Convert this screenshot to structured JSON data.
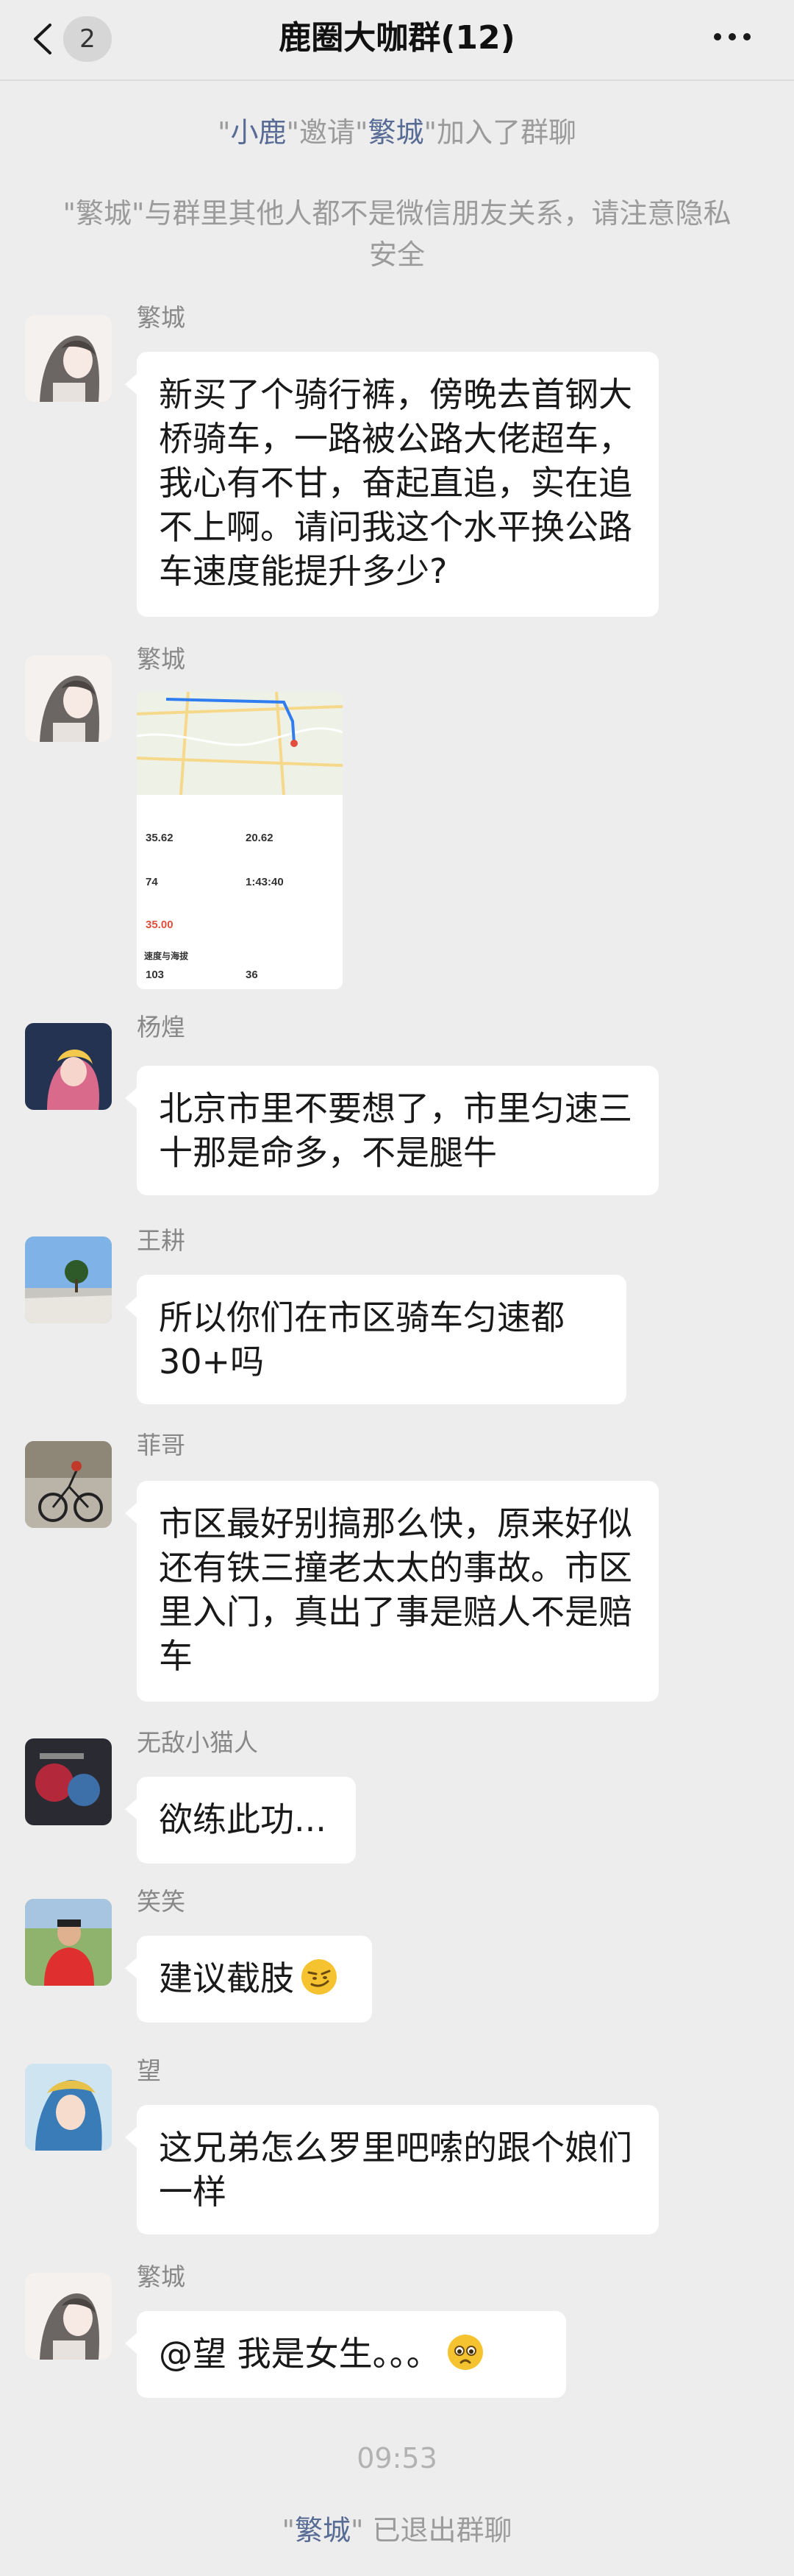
{
  "header": {
    "badge": "2",
    "title": "鹿圈大咖群(12)"
  },
  "notices": {
    "invite": {
      "q1": "\"",
      "inviter": "小鹿",
      "q2": "\"邀请\"",
      "invitee": "繁城",
      "q3": "\"加入了群聊"
    },
    "privacy": "\"繁城\"与群里其他人都不是微信朋友关系，请注意隐私安全",
    "left": {
      "q1": "\"",
      "name": "繁城",
      "q2": "\" 已退出群聊"
    }
  },
  "messages": [
    {
      "sender": "繁城",
      "text": "新买了个骑行裤，傍晚去首钢大桥骑车，一路被公路大佬超车，我心有不甘，奋起直追，实在追不上啊。请问我这个水平换公路车速度能提升多少?"
    },
    {
      "sender": "繁城",
      "type": "image"
    },
    {
      "sender": "杨煌",
      "text": "北京市里不要想了，市里匀速三十那是命多，不是腿牛"
    },
    {
      "sender": "王耕",
      "text": "所以你们在市区骑车匀速都30+吗"
    },
    {
      "sender": "菲哥",
      "text": "市区最好别搞那么快，原来好似还有铁三撞老太太的事故。市区里入门，真出了事是赔人不是赔车"
    },
    {
      "sender": "无敌小猫人",
      "text": "欲练此功..."
    },
    {
      "sender": "笑笑",
      "text": "建议截肢"
    },
    {
      "sender": "望",
      "text": "这兄弟怎么罗里吧嗦的跟个娘们一样"
    },
    {
      "sender": "繁城",
      "text": "@望 我是女生。。。"
    }
  ],
  "ride_stats": {
    "distance": "35.62",
    "avg_speed": "20.62",
    "heart": "74",
    "duration": "1:43:40",
    "max_speed": "35.00",
    "section_title": "速度与海拔",
    "v1": "103",
    "v2": "36"
  },
  "time": "09:53",
  "colors": {
    "background": "#ededed",
    "bubble": "#ffffff",
    "highlight": "#576b95",
    "notice": "#9b9b9b"
  }
}
